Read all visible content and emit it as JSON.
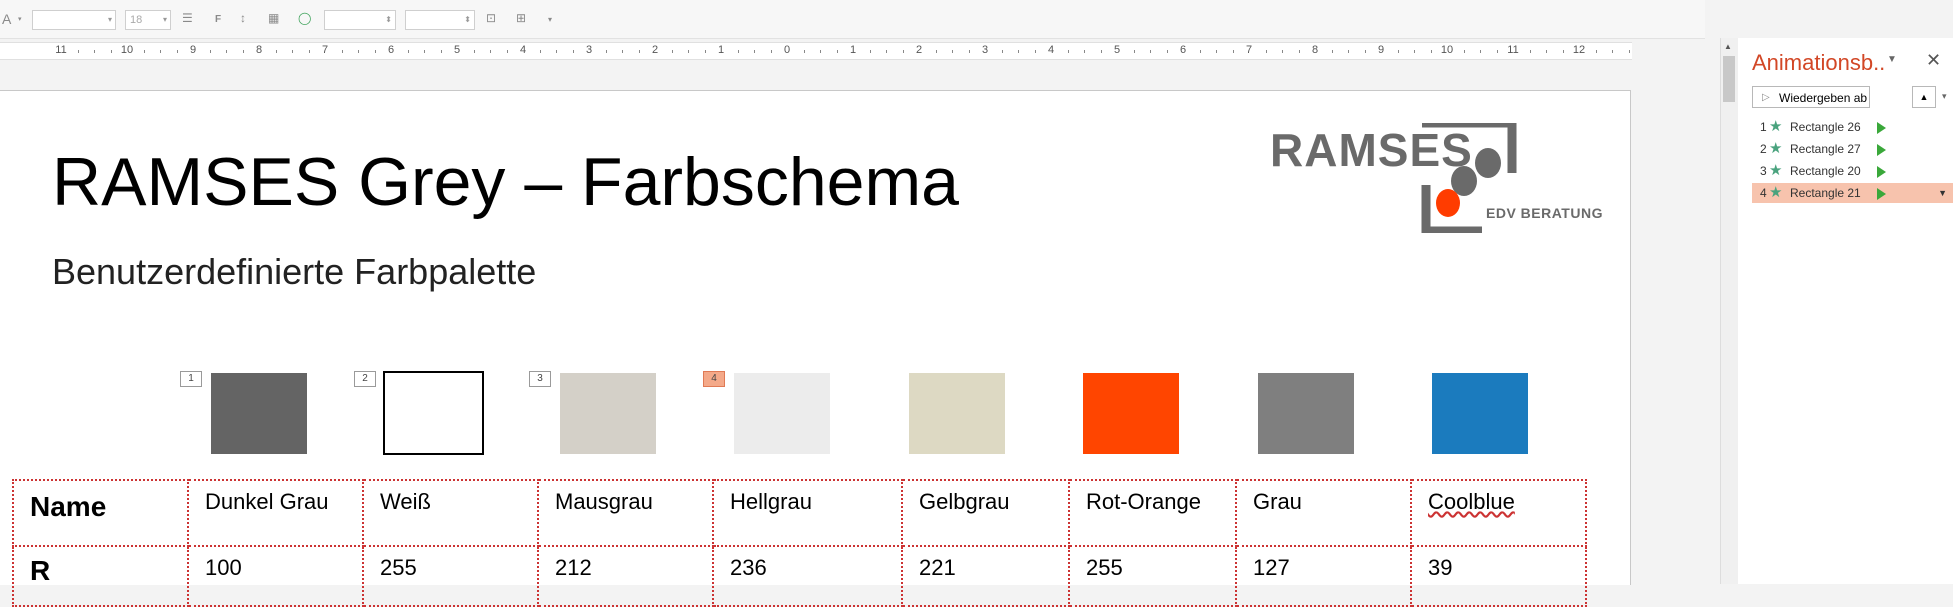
{
  "toolbar": {
    "font_name": "",
    "font_size": "18",
    "bold_label": "F",
    "font_glyph": "A",
    "width_value": "",
    "height_value": ""
  },
  "ruler": {
    "numbers": [
      "11",
      "10",
      "9",
      "8",
      "7",
      "6",
      "5",
      "4",
      "3",
      "2",
      "1",
      "0",
      "1",
      "2",
      "3",
      "4",
      "5",
      "6",
      "7",
      "8",
      "9",
      "10",
      "11",
      "12"
    ]
  },
  "slide": {
    "title": "RAMSES Grey – Farbschema",
    "subtitle": "Benutzerdefinierte Farbpalette",
    "logo": {
      "text": "RAMSES",
      "subtext": "EDV BERATUNG",
      "accent_color": "#FF3C00",
      "grey_color": "#6A6A6A"
    },
    "animation_tags": [
      "1",
      "2",
      "3",
      "4"
    ],
    "swatches": [
      {
        "color": "#646464"
      },
      {
        "color": "#FFFFFF"
      },
      {
        "color": "#D4D0C8"
      },
      {
        "color": "#ECECEC"
      },
      {
        "color": "#DDD9C3"
      },
      {
        "color": "#FF4500"
      },
      {
        "color": "#7F7F7F"
      },
      {
        "color": "#1B7BBE"
      }
    ],
    "table": {
      "row_labels": [
        "Name",
        "R"
      ],
      "names": [
        "Dunkel Grau",
        "Weiß",
        "Mausgrau",
        "Hellgrau",
        "Gelbgrau",
        "Rot-Orange",
        "Grau",
        "Coolblue"
      ],
      "r_values": [
        "100",
        "255",
        "212",
        "236",
        "221",
        "255",
        "127",
        "39"
      ]
    }
  },
  "animation_pane": {
    "title": "Animationsb..",
    "play_button": "Wiedergeben ab",
    "items": [
      {
        "num": "1",
        "label": "Rectangle 26"
      },
      {
        "num": "2",
        "label": "Rectangle 27"
      },
      {
        "num": "3",
        "label": "Rectangle 20"
      },
      {
        "num": "4",
        "label": "Rectangle 21"
      }
    ]
  }
}
